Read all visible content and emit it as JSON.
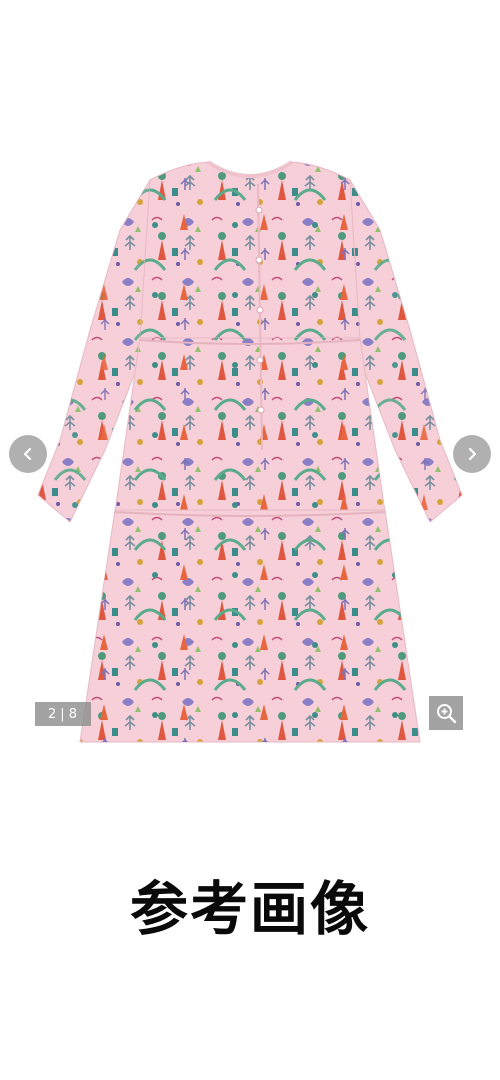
{
  "gallery": {
    "current_page": "2",
    "separator": "|",
    "total_pages": "8",
    "prev_icon": "chevron-left-icon",
    "next_icon": "chevron-right-icon",
    "zoom_icon": "zoom-in-icon"
  },
  "caption": {
    "text": "参考画像"
  },
  "colors": {
    "dress_base": "#f6cfd8",
    "nav_button_bg": "#969696",
    "overlay_bg": "#8c8c8c",
    "caption_text": "#0a0a0a"
  }
}
